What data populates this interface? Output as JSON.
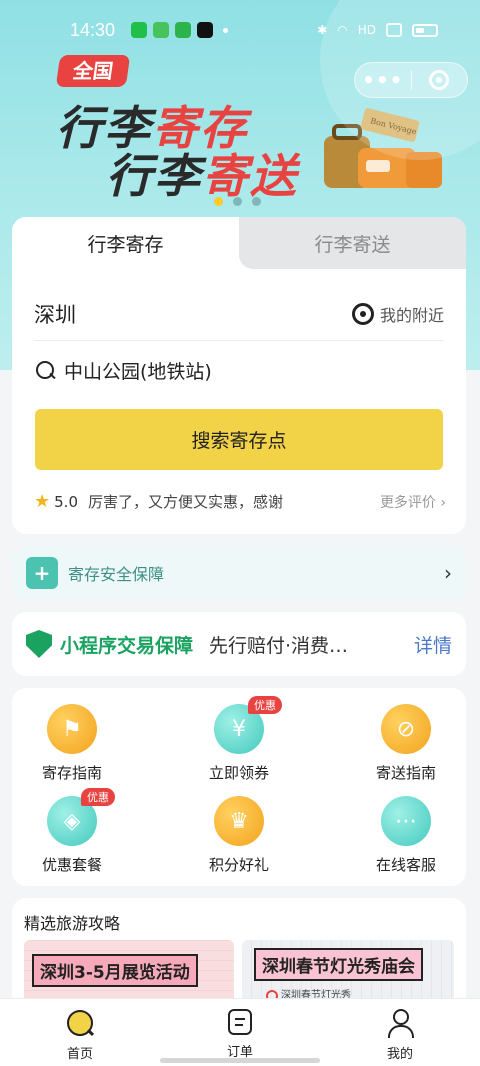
{
  "status_bar": {
    "time": "14:30",
    "network": "HD"
  },
  "capsule": {
    "menu_label": "•••"
  },
  "banner": {
    "badge": "全国",
    "line1_a": "行李",
    "line1_b": "寄存",
    "line2_a": "行李",
    "line2_b": "寄送",
    "luggage_tag": "Bon Voyage"
  },
  "search_card": {
    "tabs": [
      {
        "label": "行李寄存",
        "active": true
      },
      {
        "label": "行李寄送",
        "active": false
      }
    ],
    "city": "深圳",
    "nearby_label": "我的附近",
    "station": "中山公园(地铁站)",
    "search_button": "搜索寄存点",
    "rating": "5.0",
    "review": "厉害了，又方便又实惠，感谢",
    "more_reviews": "更多评价"
  },
  "safety_bar": {
    "label": "寄存安全保障"
  },
  "guarantee_bar": {
    "title": "小程序交易保障",
    "desc": "先行赔付·消费…",
    "link": "详情"
  },
  "services": [
    {
      "label": "寄存指南",
      "icon": "signpost-icon"
    },
    {
      "label": "立即领券",
      "icon": "coupon-icon",
      "badge": "优惠"
    },
    {
      "label": "寄送指南",
      "icon": "compass-icon"
    },
    {
      "label": "优惠套餐",
      "icon": "tag-icon",
      "badge": "优惠"
    },
    {
      "label": "积分好礼",
      "icon": "crown-icon"
    },
    {
      "label": "在线客服",
      "icon": "chat-icon"
    }
  ],
  "guides": {
    "title": "精选旅游攻略",
    "items": [
      {
        "title": "深圳3-5月展览活动"
      },
      {
        "title": "深圳春节灯光秀庙会",
        "subtitle": "深圳春节灯光秀"
      }
    ]
  },
  "bottom_nav": [
    {
      "label": "首页",
      "icon": "home-search-icon",
      "active": true
    },
    {
      "label": "订单",
      "icon": "order-icon",
      "active": false
    },
    {
      "label": "我的",
      "icon": "profile-icon",
      "active": false
    }
  ],
  "colors": {
    "accent_yellow": "#f2d247",
    "brand_red": "#e84340",
    "hero_teal": "#a8e8ea",
    "green": "#1aa260",
    "link_blue": "#4a79c9"
  }
}
